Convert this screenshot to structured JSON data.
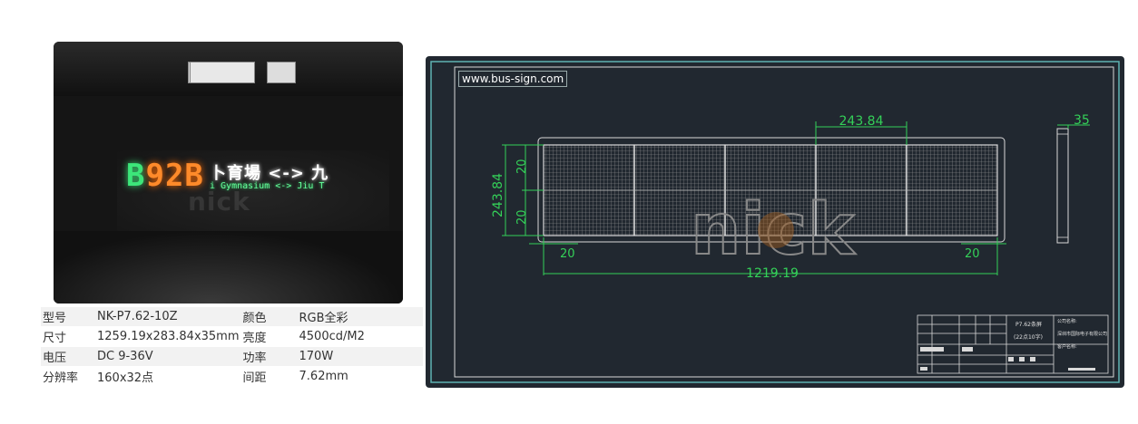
{
  "photo": {
    "route_prefix": "B",
    "route_number": "92B",
    "destination_cn": "卜育場 <-> 九",
    "destination_en": "i Gymnasium <-> Jiu T",
    "watermark": "nick"
  },
  "spec_table": [
    {
      "k1": "型号",
      "v1": "NK-P7.62-10Z",
      "k2": "颜色",
      "v2": "RGB全彩"
    },
    {
      "k1": "尺寸",
      "v1": "1259.19x283.84x35mm",
      "k2": "亮度",
      "v2": "4500cd/M2"
    },
    {
      "k1": "电压",
      "v1": "DC 9-36V",
      "k2": "功率",
      "v2": "170W"
    },
    {
      "k1": "分辨率",
      "v1": "160x32点",
      "k2": "间距",
      "v2": "7.62mm"
    }
  ],
  "drawing": {
    "site": "www.bus-sign.com",
    "dim_top": "243.84",
    "dim_side_depth": "35",
    "dim_height": "243.84",
    "dim_upper": "20",
    "dim_lower": "20",
    "dim_bottom_left": "20",
    "dim_bottom_right": "20",
    "dim_width": "1219.19",
    "watermark": "nick",
    "title_block": {
      "title_line1": "P7.62条屏",
      "title_line2": "(22点10字)",
      "company_label": "公司名称:",
      "company_name": "深圳市国际电子有限公司",
      "customer_label": "客户名称:"
    },
    "colors": {
      "line": "#d9d9d9",
      "dim": "#34d058",
      "bg": "#212830",
      "frame": "#5fb3b3"
    }
  }
}
